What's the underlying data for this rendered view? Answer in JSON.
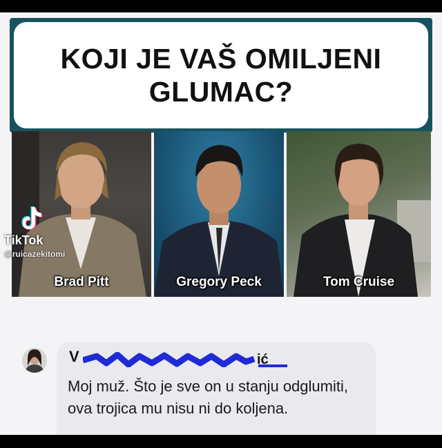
{
  "banner": {
    "question": "KOJI JE VAŠ OMILJENI GLUMAC?"
  },
  "actors": [
    {
      "name": "Brad Pitt"
    },
    {
      "name": "Gregory Peck"
    },
    {
      "name": "Tom Cruise"
    }
  ],
  "watermark": {
    "app": "TikTok",
    "handle": "@ruicazekitomi"
  },
  "comment": {
    "author_initial": "V",
    "author_suffix": "ić",
    "text": "Moj muž. Što je sve on u stanju odglumiti, ova trojica mu nisu ni do koljena."
  },
  "colors": {
    "banner_border": "#17535e",
    "redaction": "#1f2bd6",
    "bubble": "#e9e9ee"
  }
}
